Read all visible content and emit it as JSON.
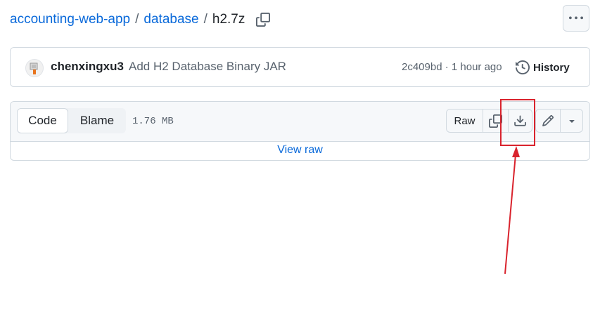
{
  "breadcrumb": {
    "repo": "accounting-web-app",
    "folder": "database",
    "separator": "/",
    "file": "h2.7z"
  },
  "commit": {
    "author": "chenxingxu3",
    "message": "Add H2 Database Binary JAR",
    "sha_time": "2c409bd · 1 hour ago",
    "history_label": "History"
  },
  "file": {
    "tab_code": "Code",
    "tab_blame": "Blame",
    "size": "1.76 MB",
    "raw_label": "Raw",
    "view_raw": "View raw"
  },
  "icons": {
    "copy_path": "copy-icon",
    "more": "kebab-horizontal-icon",
    "history": "history-icon",
    "copy_content": "copy-icon",
    "download": "download-icon",
    "edit": "pencil-icon",
    "caret": "triangle-down-icon"
  },
  "colors": {
    "link": "#0969da",
    "annotation": "#d9232d"
  }
}
